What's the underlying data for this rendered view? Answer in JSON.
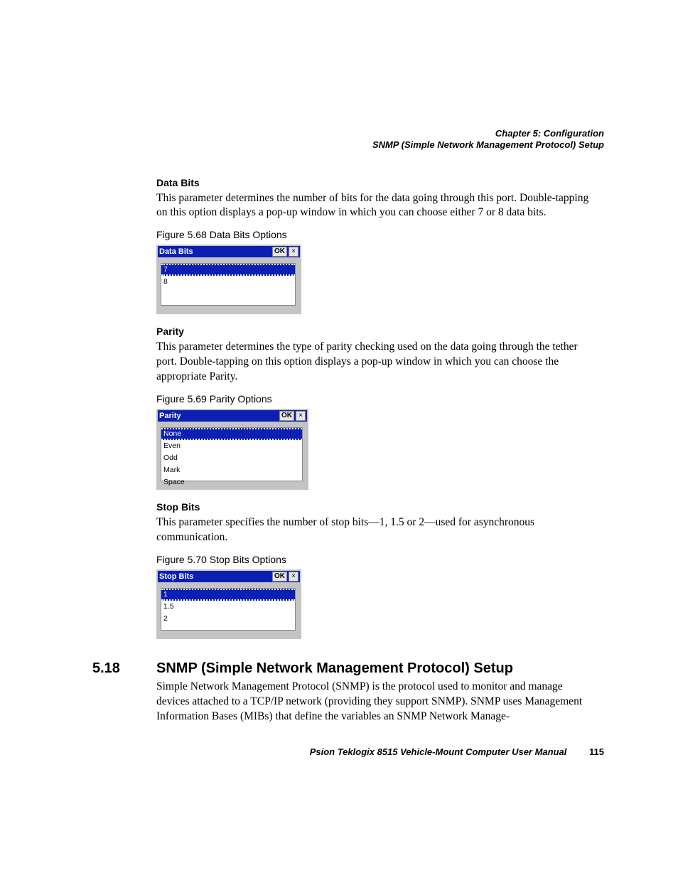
{
  "header": {
    "chapter": "Chapter 5: Configuration",
    "section": "SNMP (Simple Network Management Protocol) Setup"
  },
  "databits": {
    "heading": "Data Bits",
    "para": "This parameter determines the number of bits for the data going through this port. Double-tapping on this option displays a pop-up window in which you can choose either 7 or 8 data bits.",
    "figcap": "Figure 5.68 Data Bits Options",
    "dlg": {
      "title": "Data Bits",
      "ok": "OK",
      "close": "×",
      "options": [
        "7",
        "8"
      ],
      "selected": 0
    }
  },
  "parity": {
    "heading": "Parity",
    "para": "This parameter determines the type of parity checking used on the data going through the tether port. Double-tapping on this option displays a pop-up window in which you can choose the appropriate Parity.",
    "figcap": "Figure 5.69 Parity Options",
    "dlg": {
      "title": "Parity",
      "ok": "OK",
      "close": "×",
      "options": [
        "None",
        "Even",
        "Odd",
        "Mark",
        "Space"
      ],
      "selected": 0
    }
  },
  "stopbits": {
    "heading": "Stop Bits",
    "para": "This parameter specifies the number of stop bits—1, 1.5 or 2—used for asynchronous communication.",
    "figcap": "Figure 5.70 Stop Bits Options",
    "dlg": {
      "title": "Stop Bits",
      "ok": "OK",
      "close": "×",
      "options": [
        "1",
        "1.5",
        "2"
      ],
      "selected": 0
    }
  },
  "section518": {
    "num": "5.18",
    "title": "SNMP (Simple Network Management Protocol) Setup",
    "para": "Simple Network Management Protocol (SNMP) is the protocol used to monitor and manage devices attached to a TCP/IP network (providing they support SNMP). SNMP uses Management Information Bases (MIBs) that define the variables an SNMP Network Manage-"
  },
  "footer": {
    "text": "Psion Teklogix 8515 Vehicle-Mount Computer User Manual",
    "page": "115"
  }
}
